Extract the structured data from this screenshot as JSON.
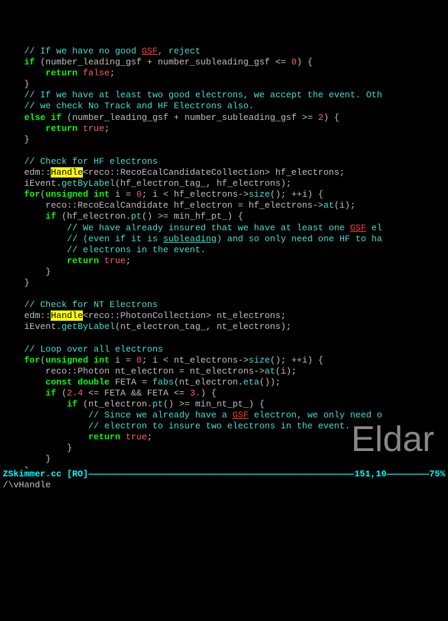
{
  "lines": [
    {
      "indent": "    ",
      "segs": [
        {
          "cls": "c-comment",
          "t": "// If we have no good "
        },
        {
          "cls": "spell-err",
          "t": "GSF"
        },
        {
          "cls": "c-comment",
          "t": ", reject"
        }
      ]
    },
    {
      "indent": "    ",
      "segs": [
        {
          "cls": "c-keyword",
          "t": "if"
        },
        {
          "cls": "c-ident",
          "t": " (number_leading_gsf + number_subleading_gsf <= "
        },
        {
          "cls": "c-number",
          "t": "0"
        },
        {
          "cls": "c-ident",
          "t": ") {"
        }
      ]
    },
    {
      "indent": "        ",
      "segs": [
        {
          "cls": "c-keyword",
          "t": "return"
        },
        {
          "cls": "c-ident",
          "t": " "
        },
        {
          "cls": "c-number",
          "t": "false"
        },
        {
          "cls": "c-ident",
          "t": ";"
        }
      ]
    },
    {
      "indent": "    ",
      "segs": [
        {
          "cls": "c-ident",
          "t": "}"
        }
      ]
    },
    {
      "indent": "    ",
      "segs": [
        {
          "cls": "c-comment",
          "t": "// If we have at least two good electrons, we accept the event. Oth"
        }
      ]
    },
    {
      "indent": "    ",
      "segs": [
        {
          "cls": "c-comment",
          "t": "// we check No Track and HF Electrons also."
        }
      ]
    },
    {
      "indent": "    ",
      "segs": [
        {
          "cls": "c-keyword",
          "t": "else"
        },
        {
          "cls": "c-ident",
          "t": " "
        },
        {
          "cls": "c-keyword",
          "t": "if"
        },
        {
          "cls": "c-ident",
          "t": " (number_leading_gsf + number_subleading_gsf >= "
        },
        {
          "cls": "c-number",
          "t": "2"
        },
        {
          "cls": "c-ident",
          "t": ") {"
        }
      ]
    },
    {
      "indent": "        ",
      "segs": [
        {
          "cls": "c-keyword",
          "t": "return"
        },
        {
          "cls": "c-ident",
          "t": " "
        },
        {
          "cls": "c-number",
          "t": "true"
        },
        {
          "cls": "c-ident",
          "t": ";"
        }
      ]
    },
    {
      "indent": "    ",
      "segs": [
        {
          "cls": "c-ident",
          "t": "}"
        }
      ]
    },
    {
      "indent": "",
      "segs": [
        {
          "cls": "c-ident",
          "t": " "
        }
      ]
    },
    {
      "indent": "    ",
      "segs": [
        {
          "cls": "c-comment",
          "t": "// Check for HF electrons"
        }
      ]
    },
    {
      "indent": "    ",
      "segs": [
        {
          "cls": "c-ident",
          "t": "edm::"
        },
        {
          "cls": "hl-search",
          "t": "Handle"
        },
        {
          "cls": "c-ident",
          "t": "<reco::RecoEcalCandidateCollection> hf_electrons;"
        }
      ]
    },
    {
      "indent": "    ",
      "segs": [
        {
          "cls": "c-ident",
          "t": "iEvent."
        },
        {
          "cls": "c-func",
          "t": "getByLabel"
        },
        {
          "cls": "c-ident",
          "t": "(hf_electron_tag_, hf_electrons);"
        }
      ]
    },
    {
      "indent": "    ",
      "segs": [
        {
          "cls": "c-keyword",
          "t": "for"
        },
        {
          "cls": "c-ident",
          "t": "("
        },
        {
          "cls": "c-type",
          "t": "unsigned"
        },
        {
          "cls": "c-ident",
          "t": " "
        },
        {
          "cls": "c-type",
          "t": "int"
        },
        {
          "cls": "c-ident",
          "t": " i = "
        },
        {
          "cls": "c-number",
          "t": "0"
        },
        {
          "cls": "c-ident",
          "t": "; i < hf_electrons->"
        },
        {
          "cls": "c-func",
          "t": "size"
        },
        {
          "cls": "c-ident",
          "t": "(); ++i) {"
        }
      ]
    },
    {
      "indent": "        ",
      "segs": [
        {
          "cls": "c-ident",
          "t": "reco::RecoEcalCandidate hf_electron = hf_electrons->"
        },
        {
          "cls": "c-func",
          "t": "at"
        },
        {
          "cls": "c-ident",
          "t": "(i);"
        }
      ]
    },
    {
      "indent": "        ",
      "segs": [
        {
          "cls": "c-keyword",
          "t": "if"
        },
        {
          "cls": "c-ident",
          "t": " (hf_electron."
        },
        {
          "cls": "c-func",
          "t": "pt"
        },
        {
          "cls": "c-ident",
          "t": "() >= min_hf_pt_) {"
        }
      ]
    },
    {
      "indent": "            ",
      "segs": [
        {
          "cls": "c-comment",
          "t": "// We have already insured that we have at least one "
        },
        {
          "cls": "spell-err",
          "t": "GSF"
        },
        {
          "cls": "c-comment",
          "t": " el"
        }
      ]
    },
    {
      "indent": "            ",
      "segs": [
        {
          "cls": "c-comment",
          "t": "// (even if it is "
        },
        {
          "cls": "spell-err2",
          "t": "subleading"
        },
        {
          "cls": "c-comment",
          "t": ") and so only need one HF to ha"
        }
      ]
    },
    {
      "indent": "            ",
      "segs": [
        {
          "cls": "c-comment",
          "t": "// electrons in the event."
        }
      ]
    },
    {
      "indent": "            ",
      "segs": [
        {
          "cls": "c-keyword",
          "t": "return"
        },
        {
          "cls": "c-ident",
          "t": " "
        },
        {
          "cls": "c-number",
          "t": "true"
        },
        {
          "cls": "c-ident",
          "t": ";"
        }
      ]
    },
    {
      "indent": "        ",
      "segs": [
        {
          "cls": "c-ident",
          "t": "}"
        }
      ]
    },
    {
      "indent": "    ",
      "segs": [
        {
          "cls": "c-ident",
          "t": "}"
        }
      ]
    },
    {
      "indent": "",
      "segs": [
        {
          "cls": "c-ident",
          "t": " "
        }
      ]
    },
    {
      "indent": "    ",
      "segs": [
        {
          "cls": "c-comment",
          "t": "// Check for NT Electrons"
        }
      ]
    },
    {
      "indent": "    ",
      "segs": [
        {
          "cls": "c-ident",
          "t": "edm::"
        },
        {
          "cls": "hl-search",
          "t": "Handle"
        },
        {
          "cls": "c-ident",
          "t": "<reco::PhotonCollection> nt_electrons;"
        }
      ]
    },
    {
      "indent": "    ",
      "segs": [
        {
          "cls": "c-ident",
          "t": "iEvent."
        },
        {
          "cls": "c-func",
          "t": "getByLabel"
        },
        {
          "cls": "c-ident",
          "t": "(nt_electron_tag_, nt_electrons);"
        }
      ]
    },
    {
      "indent": "",
      "segs": [
        {
          "cls": "c-ident",
          "t": " "
        }
      ]
    },
    {
      "indent": "    ",
      "segs": [
        {
          "cls": "c-comment",
          "t": "// Loop over all electrons"
        }
      ]
    },
    {
      "indent": "    ",
      "segs": [
        {
          "cls": "c-keyword",
          "t": "for"
        },
        {
          "cls": "c-ident",
          "t": "("
        },
        {
          "cls": "c-type",
          "t": "unsigned"
        },
        {
          "cls": "c-ident",
          "t": " "
        },
        {
          "cls": "c-type",
          "t": "int"
        },
        {
          "cls": "c-ident",
          "t": " i = "
        },
        {
          "cls": "c-number",
          "t": "0"
        },
        {
          "cls": "c-ident",
          "t": "; i < nt_electrons->"
        },
        {
          "cls": "c-func",
          "t": "size"
        },
        {
          "cls": "c-ident",
          "t": "(); ++i) {"
        }
      ]
    },
    {
      "indent": "        ",
      "segs": [
        {
          "cls": "c-ident",
          "t": "reco::Photon nt_electron = nt_electrons->"
        },
        {
          "cls": "c-func",
          "t": "at"
        },
        {
          "cls": "c-ident",
          "t": "(i);"
        }
      ]
    },
    {
      "indent": "        ",
      "segs": [
        {
          "cls": "c-type",
          "t": "const"
        },
        {
          "cls": "c-ident",
          "t": " "
        },
        {
          "cls": "c-type",
          "t": "double"
        },
        {
          "cls": "c-ident",
          "t": " FETA = "
        },
        {
          "cls": "c-func",
          "t": "fabs"
        },
        {
          "cls": "c-ident",
          "t": "(nt_electron."
        },
        {
          "cls": "c-func",
          "t": "eta"
        },
        {
          "cls": "c-ident",
          "t": "());"
        }
      ]
    },
    {
      "indent": "        ",
      "segs": [
        {
          "cls": "c-keyword",
          "t": "if"
        },
        {
          "cls": "c-ident",
          "t": " ("
        },
        {
          "cls": "c-number",
          "t": "2.4"
        },
        {
          "cls": "c-ident",
          "t": " <= FETA && FETA <= "
        },
        {
          "cls": "c-number",
          "t": "3."
        },
        {
          "cls": "c-ident",
          "t": ") {"
        }
      ]
    },
    {
      "indent": "            ",
      "segs": [
        {
          "cls": "c-keyword",
          "t": "if"
        },
        {
          "cls": "c-ident",
          "t": " (nt_electron."
        },
        {
          "cls": "c-func",
          "t": "pt"
        },
        {
          "cls": "c-ident",
          "t": "() >= min_nt_pt_) {"
        }
      ]
    },
    {
      "indent": "                ",
      "segs": [
        {
          "cls": "c-comment",
          "t": "// Since we already have a "
        },
        {
          "cls": "spell-err",
          "t": "GSF"
        },
        {
          "cls": "c-comment",
          "t": " electron, we only need o"
        }
      ]
    },
    {
      "indent": "                ",
      "segs": [
        {
          "cls": "c-comment",
          "t": "// electron to insure two electrons in the event."
        }
      ]
    },
    {
      "indent": "                ",
      "segs": [
        {
          "cls": "c-keyword",
          "t": "return"
        },
        {
          "cls": "c-ident",
          "t": " "
        },
        {
          "cls": "c-number",
          "t": "true"
        },
        {
          "cls": "c-ident",
          "t": ";"
        }
      ]
    },
    {
      "indent": "            ",
      "segs": [
        {
          "cls": "c-ident",
          "t": "}"
        }
      ]
    },
    {
      "indent": "        ",
      "segs": [
        {
          "cls": "c-ident",
          "t": "}"
        }
      ]
    },
    {
      "indent": "    ",
      "segs": [
        {
          "cls": "c-ident",
          "t": "}"
        }
      ]
    },
    {
      "indent": "",
      "segs": [
        {
          "cls": "c-ident",
          "t": " "
        }
      ]
    },
    {
      "indent": "",
      "segs": [
        {
          "cls": "c-ident",
          "t": " "
        }
      ]
    }
  ],
  "status": {
    "filename": "ZSkimmer.cc",
    "readonly": " [RO]",
    "position": "151,10",
    "percent": "75%"
  },
  "cmdline": "/\\vHandle",
  "watermark": "Eldar"
}
